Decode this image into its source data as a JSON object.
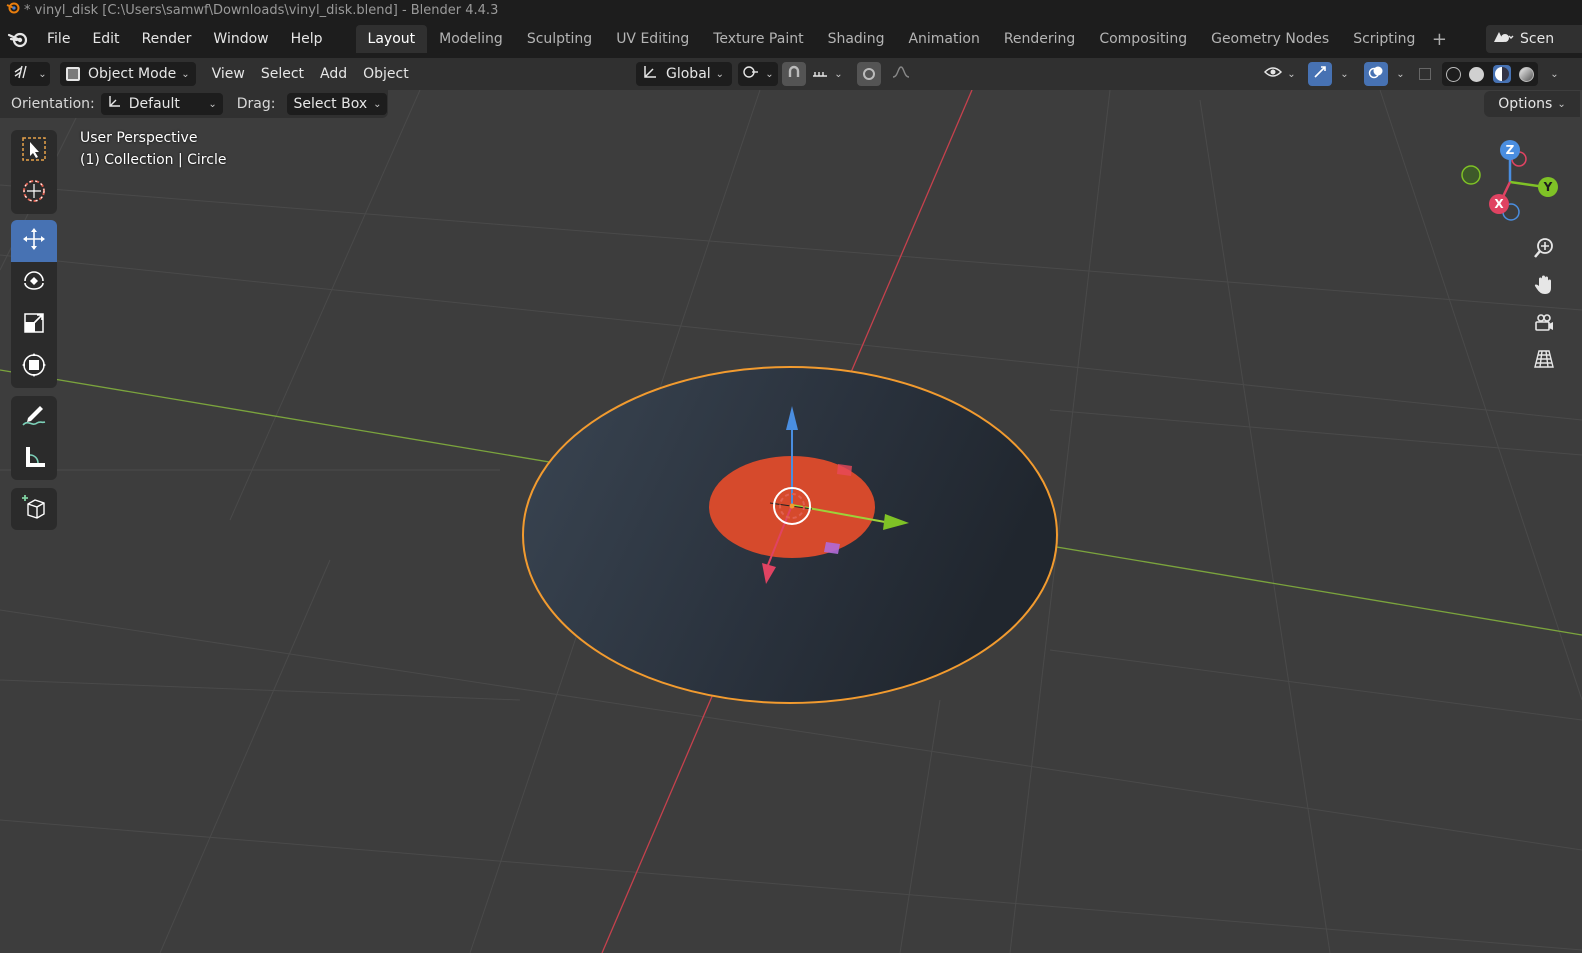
{
  "window": {
    "title": "* vinyl_disk [C:\\Users\\samwf\\Downloads\\vinyl_disk.blend] - Blender 4.4.3"
  },
  "menubar": {
    "items": [
      "File",
      "Edit",
      "Render",
      "Window",
      "Help"
    ],
    "workspaces": [
      "Layout",
      "Modeling",
      "Sculpting",
      "UV Editing",
      "Texture Paint",
      "Shading",
      "Animation",
      "Rendering",
      "Compositing",
      "Geometry Nodes",
      "Scripting"
    ],
    "active_workspace": "Layout",
    "add_workspace": "+",
    "scene_label": "Scen"
  },
  "header": {
    "mode": "Object Mode",
    "menus": [
      "View",
      "Select",
      "Add",
      "Object"
    ],
    "transform_orientation": "Global"
  },
  "tool_settings": {
    "orientation_label": "Orientation:",
    "orientation_value": "Default",
    "drag_label": "Drag:",
    "drag_value": "Select Box",
    "options_label": "Options"
  },
  "viewport": {
    "view_name": "User Perspective",
    "collection_info": "(1) Collection | Circle",
    "selection_outline_color": "#f29b2f",
    "disk_color": "#2c3540",
    "label_color": "#d64a2c",
    "x_axis_color": "#c5414d",
    "y_axis_color": "#7ba43d"
  },
  "gizmo": {
    "x": "X",
    "y": "Y",
    "z": "Z"
  },
  "icons": {
    "toolbar": [
      "select-box-icon",
      "cursor-icon",
      "move-icon",
      "rotate-icon",
      "scale-icon",
      "transform-icon",
      "annotate-icon",
      "measure-icon",
      "add-cube-icon"
    ],
    "navigation": [
      "zoom-icon",
      "pan-hand-icon",
      "camera-icon",
      "grid-icon"
    ]
  }
}
